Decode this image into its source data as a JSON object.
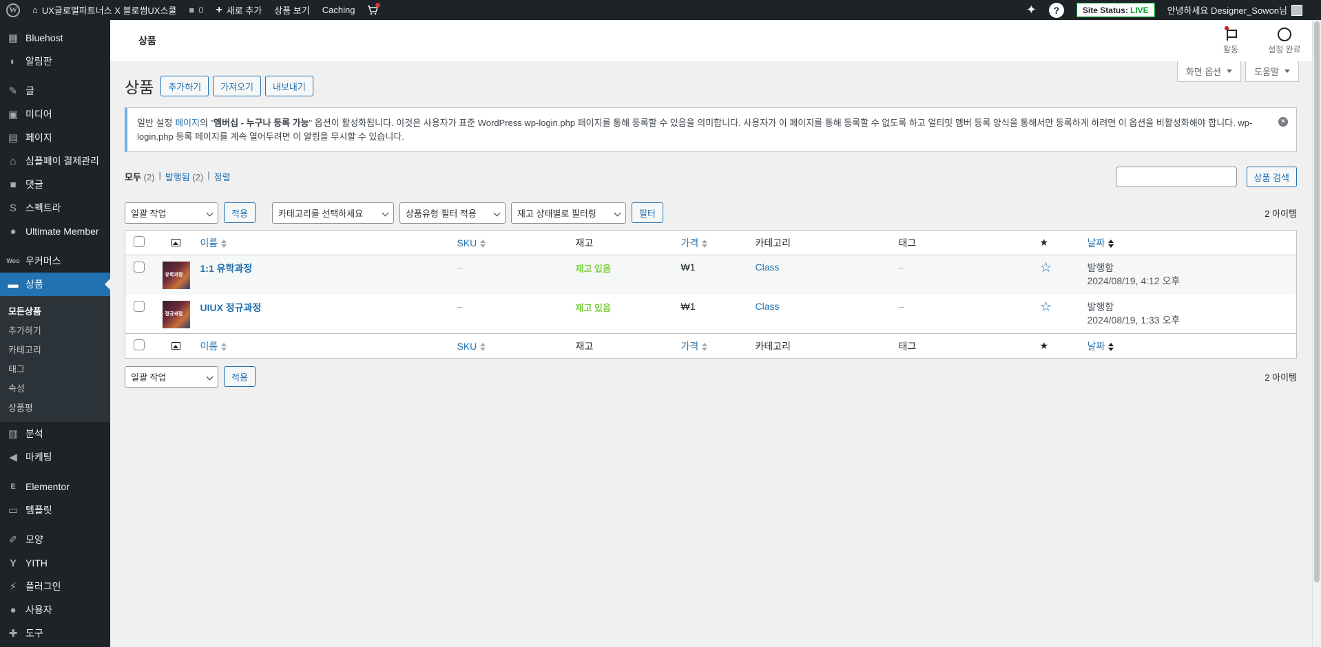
{
  "adminbar": {
    "site_name": "UX글로벌파트너스 X 블로썸UX스쿨",
    "comments_count": "0",
    "new_label": "새로 추가",
    "view_products": "상품 보기",
    "caching": "Caching",
    "site_status_label": "Site Status:",
    "site_status_value": "LIVE",
    "greeting": "안녕하세요 Designer_Sowon님"
  },
  "sidebar": {
    "items": [
      {
        "label": "Bluehost",
        "icon": "grid-icon"
      },
      {
        "label": "알림판",
        "icon": "dashboard-icon"
      },
      {
        "label": "글",
        "icon": "pin-icon"
      },
      {
        "label": "미디어",
        "icon": "media-icon"
      },
      {
        "label": "페이지",
        "icon": "page-icon"
      },
      {
        "label": "심플페이 결제관리",
        "icon": "bank-icon"
      },
      {
        "label": "댓글",
        "icon": "comment-icon"
      },
      {
        "label": "스펙트라",
        "icon": "spectra-icon"
      },
      {
        "label": "Ultimate Member",
        "icon": "user-icon"
      },
      {
        "label": "우커머스",
        "icon": "woo-icon"
      },
      {
        "label": "상품",
        "icon": "archive-icon"
      },
      {
        "label": "분석",
        "icon": "chart-icon"
      },
      {
        "label": "마케팅",
        "icon": "megaphone-icon"
      },
      {
        "label": "Elementor",
        "icon": "elementor-icon"
      },
      {
        "label": "템플릿",
        "icon": "folder-icon"
      },
      {
        "label": "모양",
        "icon": "brush-icon"
      },
      {
        "label": "YITH",
        "icon": "yith-icon"
      },
      {
        "label": "플러그인",
        "icon": "plugin-icon"
      },
      {
        "label": "사용자",
        "icon": "users-icon"
      },
      {
        "label": "도구",
        "icon": "wrench-icon"
      }
    ],
    "submenu": [
      "모든상품",
      "추가하기",
      "카테고리",
      "태그",
      "속성",
      "상품평"
    ]
  },
  "header": {
    "title": "상품",
    "activity": "활동",
    "setup": "설정 완료"
  },
  "screen_meta": {
    "screen_options": "화면 옵션",
    "help": "도움말"
  },
  "page": {
    "title": "상품",
    "btn_add": "추가하기",
    "btn_import": "가져오기",
    "btn_export": "내보내기"
  },
  "notice": {
    "text_1": "일반 설정 ",
    "link": "페이지",
    "text_2": "의 \"",
    "bold": "멤버십 - 누구나 등록 가능",
    "text_3": "\" 옵션이 활성화됩니다. 이것은 사용자가 표준 WordPress wp-login.php 페이지를 통해 등록할 수 있음을 의미합니다. 사용자가 이 페이지를 통해 등록할 수 없도록 하고 얼티밋 멤버 등록 양식을 통해서만 등록하게 하려면 이 옵션을 비활성화해야 합니다. wp-login.php 등록 페이지를 계속 열어두려면 이 알림을 무시할 수 있습니다."
  },
  "filters": {
    "all": "모두",
    "all_count": "(2)",
    "published": "발행됨",
    "published_count": "(2)",
    "sort": "정렬",
    "search_button": "상품 검색",
    "search_value": "",
    "bulk_action": "일괄 작업",
    "apply": "적용",
    "category_select": "카테고리를 선택하세요",
    "type_filter": "상품유형 필터 적용",
    "stock_filter": "재고 상태별로 필터링",
    "filter_button": "필터",
    "item_count": "2 아이템"
  },
  "table": {
    "columns": {
      "name": "이름",
      "sku": "SKU",
      "stock": "재고",
      "price": "가격",
      "category": "카테고리",
      "tags": "태그",
      "date": "날짜"
    },
    "rows": [
      {
        "name": "1:1 유학과정",
        "thumb_text": "유학과정",
        "sku": "–",
        "stock": "재고 있음",
        "price": "₩1",
        "category": "Class",
        "tags": "–",
        "status": "발행함",
        "date": "2024/08/19, 4:12 오후"
      },
      {
        "name": "UIUX 정규과정",
        "thumb_text": "정규과정",
        "sku": "–",
        "stock": "재고 있음",
        "price": "₩1",
        "category": "Class",
        "tags": "–",
        "status": "발행함",
        "date": "2024/08/19, 1:33 오후"
      }
    ]
  },
  "bottom": {
    "bulk_action": "일괄 작업",
    "apply": "적용",
    "item_count": "2 아이템"
  }
}
